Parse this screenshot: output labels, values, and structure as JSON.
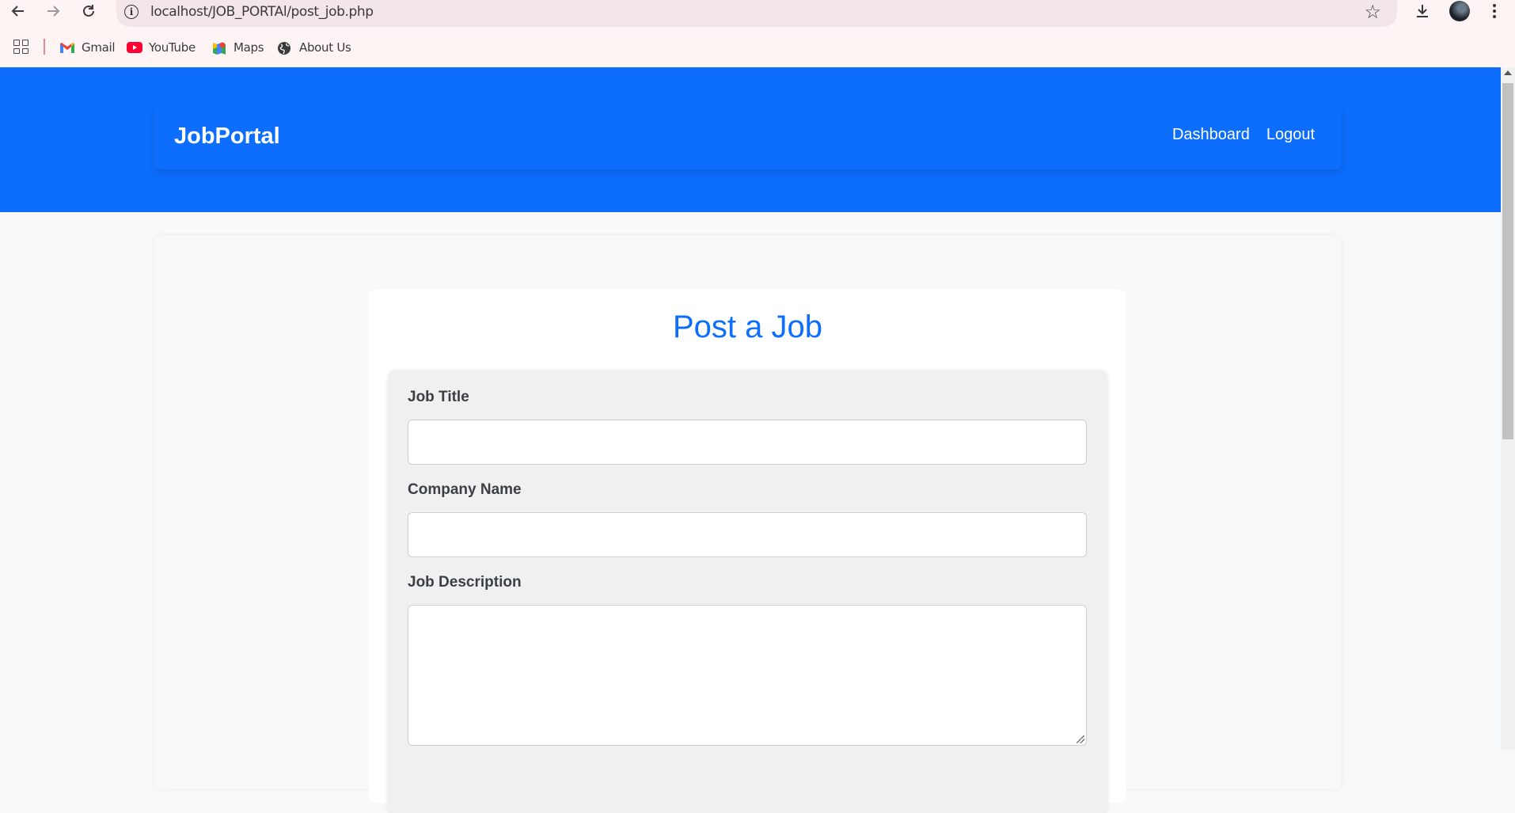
{
  "browser": {
    "url": "localhost/JOB_PORTAl/post_job.php",
    "bookmarks": [
      {
        "label": "Gmail",
        "icon": "gmail-icon"
      },
      {
        "label": "YouTube",
        "icon": "youtube-icon"
      },
      {
        "label": "Maps",
        "icon": "maps-icon"
      },
      {
        "label": "About Us",
        "icon": "globe-icon"
      }
    ]
  },
  "navbar": {
    "brand": "JobPortal",
    "links": [
      "Dashboard",
      "Logout"
    ]
  },
  "form": {
    "title": "Post a Job",
    "fields": [
      {
        "label": "Job Title",
        "value": ""
      },
      {
        "label": "Company Name",
        "value": ""
      },
      {
        "label": "Job Description",
        "value": ""
      }
    ]
  },
  "colors": {
    "primary": "#0d6efd",
    "chrome": "#fff4f4",
    "omnibox": "#f3e6ea"
  }
}
